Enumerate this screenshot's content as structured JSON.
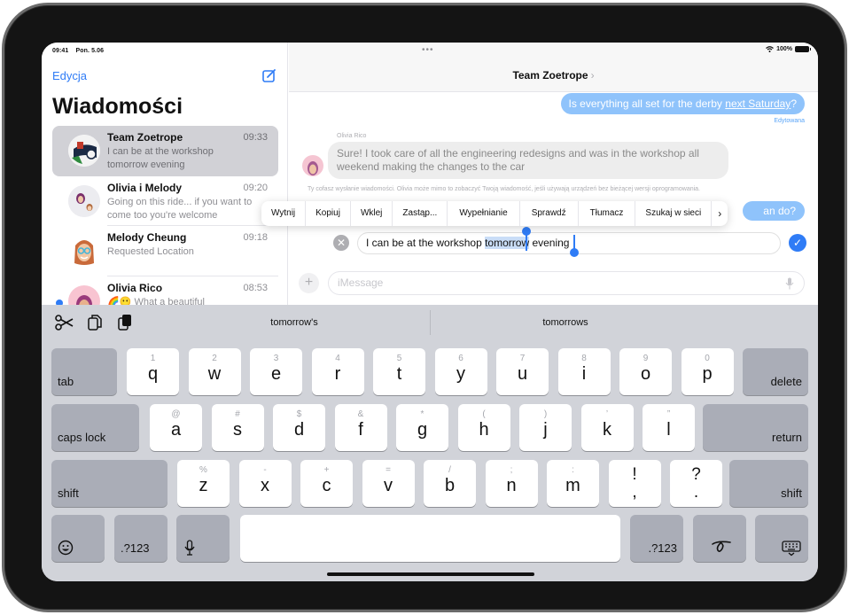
{
  "status_bar": {
    "time": "09:41",
    "date": "Pon. 5.06",
    "battery": "100%"
  },
  "sidebar": {
    "edit_label": "Edycja",
    "title": "Wiadomości",
    "conversations": [
      {
        "name": "Team Zoetrope",
        "time": "09:33",
        "preview": "I can be at the workshop tomorrow evening",
        "selected": true
      },
      {
        "name": "Olivia i Melody",
        "time": "09:20",
        "preview": "Going on this ride... if you want to come too you're welcome"
      },
      {
        "name": "Melody Cheung",
        "time": "09:18",
        "preview": "Requested Location"
      },
      {
        "name": "Olivia Rico",
        "time": "08:53",
        "preview": "🌈😶 What a beautiful",
        "unread": true
      }
    ]
  },
  "conversation": {
    "title": "Team Zoetrope",
    "messages": {
      "outgoing_1_before": "Is everything all set for the derby ",
      "outgoing_1_link": "next Saturday",
      "outgoing_1_after": "?",
      "edited_label": "Edytowana",
      "incoming_sender": "Olivia Rico",
      "incoming_1": "Sure! I took care of all the engineering redesigns and was in the workshop all weekend making the changes to the car",
      "unsend_note": "Ty cofasz wysłanie wiadomości. Olivia może mimo to zobaczyć Twoją wiadomość, jeśli używają urządzeń bez bieżącej wersji oprogramowania.",
      "outgoing_2_partial": "an do?"
    },
    "context_menu": [
      "Wytnij",
      "Kopiuj",
      "Wklej",
      "Zastąp...",
      "Wypełnianie",
      "Sprawdź",
      "Tłumacz",
      "Szukaj w sieci"
    ],
    "context_more": "›",
    "edit_field": {
      "before": "I can be at the workshop ",
      "selected": "tomorrow",
      "after": " evening"
    },
    "input_placeholder": "iMessage"
  },
  "keyboard": {
    "suggestions": [
      "tomorrow's",
      "tomorrows"
    ],
    "row1": [
      {
        "hint": "1",
        "key": "q"
      },
      {
        "hint": "2",
        "key": "w"
      },
      {
        "hint": "3",
        "key": "e"
      },
      {
        "hint": "4",
        "key": "r"
      },
      {
        "hint": "5",
        "key": "t"
      },
      {
        "hint": "6",
        "key": "y"
      },
      {
        "hint": "7",
        "key": "u"
      },
      {
        "hint": "8",
        "key": "i"
      },
      {
        "hint": "9",
        "key": "o"
      },
      {
        "hint": "0",
        "key": "p"
      }
    ],
    "row2": [
      {
        "hint": "@",
        "key": "a"
      },
      {
        "hint": "#",
        "key": "s"
      },
      {
        "hint": "$",
        "key": "d"
      },
      {
        "hint": "&",
        "key": "f"
      },
      {
        "hint": "*",
        "key": "g"
      },
      {
        "hint": "(",
        "key": "h"
      },
      {
        "hint": ")",
        "key": "j"
      },
      {
        "hint": "’",
        "key": "k"
      },
      {
        "hint": "”",
        "key": "l"
      }
    ],
    "row3": [
      {
        "hint": "%",
        "key": "z"
      },
      {
        "hint": "-",
        "key": "x"
      },
      {
        "hint": "+",
        "key": "c"
      },
      {
        "hint": "=",
        "key": "v"
      },
      {
        "hint": "/",
        "key": "b"
      },
      {
        "hint": ";",
        "key": "n"
      },
      {
        "hint": ":",
        "key": "m"
      }
    ],
    "punct": [
      {
        "top": "!",
        "bottom": ","
      },
      {
        "top": "?",
        "bottom": "."
      }
    ],
    "tab": "tab",
    "delete": "delete",
    "caps_lock": "caps lock",
    "return": "return",
    "shift": "shift",
    "numbers": ".?123"
  }
}
